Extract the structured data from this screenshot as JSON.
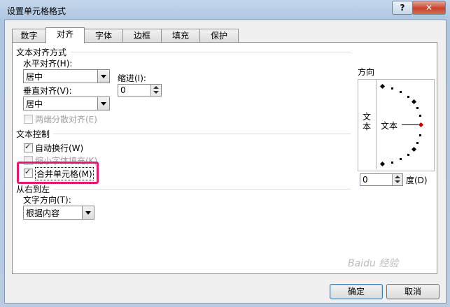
{
  "window": {
    "title": "设置单元格格式",
    "help_label": "?",
    "close_label": "✕"
  },
  "tabs": [
    {
      "label": "数字",
      "active": false
    },
    {
      "label": "对齐",
      "active": true
    },
    {
      "label": "字体",
      "active": false
    },
    {
      "label": "边框",
      "active": false
    },
    {
      "label": "填充",
      "active": false
    },
    {
      "label": "保护",
      "active": false
    }
  ],
  "text_alignment": {
    "section_title": "文本对齐方式",
    "horizontal_label": "水平对齐(H):",
    "horizontal_value": "居中",
    "indent_label": "缩进(I):",
    "indent_value": "0",
    "vertical_label": "垂直对齐(V):",
    "vertical_value": "居中",
    "justify_distributed_label": "两端分散对齐(E)"
  },
  "text_control": {
    "section_title": "文本控制",
    "wrap_text_label": "自动换行(W)",
    "wrap_text_checked": true,
    "shrink_to_fit_label": "缩小字体填充(K)",
    "shrink_to_fit_checked": false,
    "merge_cells_label": "合并单元格(M)",
    "merge_cells_checked": true
  },
  "rtl": {
    "section_title": "从右到左",
    "direction_label": "文字方向(T):",
    "direction_value": "根据内容"
  },
  "orientation": {
    "section_title": "方向",
    "vertical_text": "文本",
    "horizontal_text": "文本",
    "degrees_value": "0",
    "degrees_label": "度(D)"
  },
  "buttons": {
    "ok_label": "确定",
    "cancel_label": "取消"
  },
  "watermark": "Baidu 经验",
  "colors": {
    "highlight": "#e4186e",
    "close": "#c8412b"
  }
}
